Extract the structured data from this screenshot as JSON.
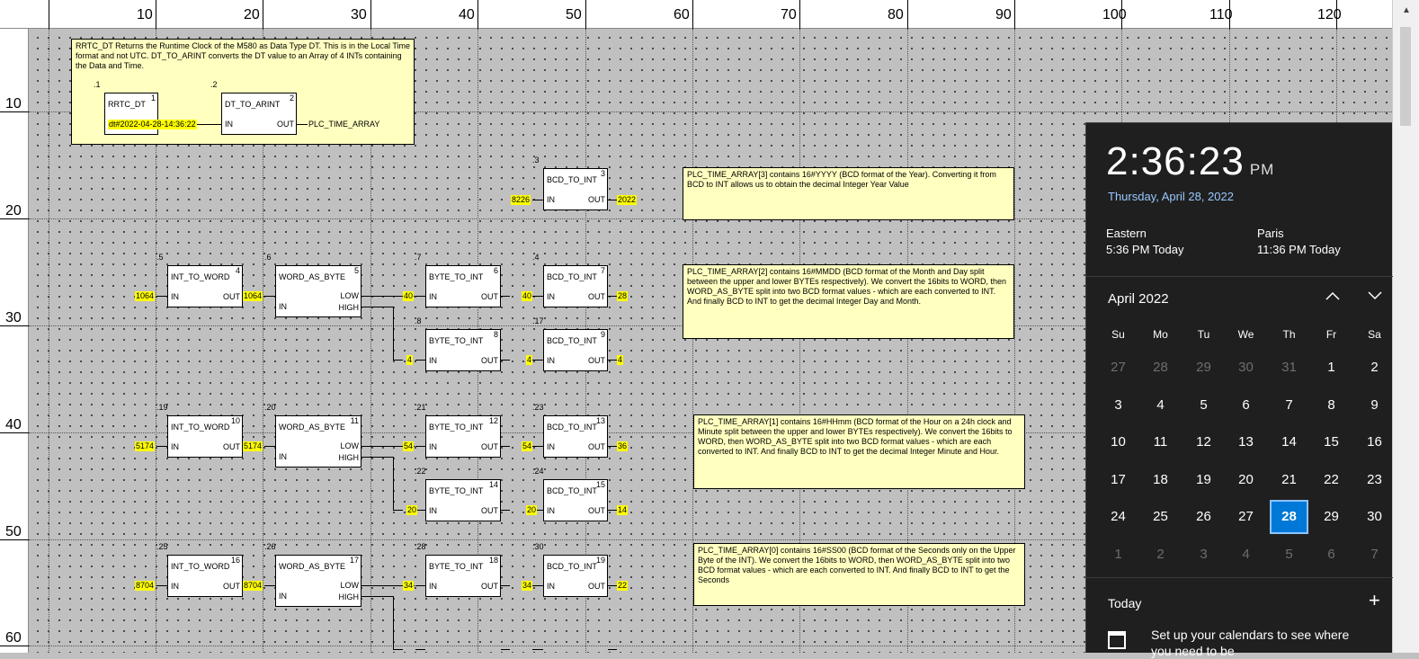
{
  "ruler": {
    "cols": [
      "10",
      "20",
      "30",
      "40",
      "50",
      "60",
      "70",
      "80",
      "90",
      "100",
      "110",
      "120"
    ],
    "rows": [
      "10",
      "20",
      "30",
      "40",
      "50",
      "60"
    ]
  },
  "comments": {
    "c1": "RRTC_DT Returns the Runtime Clock of the M580 as Data Type DT. This is in the Local Time format and not UTC. DT_TO_ARINT converts the DT value to an Array of 4 INTs containing the Data and Time.",
    "c2": "PLC_TIME_ARRAY[3] contains 16#YYYY (BCD format of the Year). Converting it from BCD to INT allows us to obtain the decimal Integer Year Value",
    "c3": "PLC_TIME_ARRAY[2] contains 16#MMDD (BCD format of the Month and Day split between the upper and lower BYTEs respectively). We convert the 16bits to WORD, then WORD_AS_BYTE split into two BCD format values - which are each converted to INT. And finally BCD to INT to get the decimal Integer Day and Month.",
    "c4": "PLC_TIME_ARRAY[1] contains 16#HHmm (BCD format of the Hour on a 24h clock and Minute split between the upper and lower BYTEs respectively). We convert the 16bits to WORD, then WORD_AS_BYTE split into two BCD format values - which are each converted to INT. And finally BCD to INT to get the decimal Integer Minute and Hour.",
    "c5": "PLC_TIME_ARRAY[0] contains 16#SS00 (BCD format of the Seconds only on the Upper Byte of the INT). We convert the 16bits to WORD, then WORD_AS_BYTE split into two BCD format values - which are each converted to INT. And finally BCD to INT to get the Seconds"
  },
  "blocks": {
    "b1": {
      "name": "RRTC_DT",
      "num": "1",
      "idx": ".1"
    },
    "b2": {
      "name": "DT_TO_ARINT",
      "num": "2",
      "idx": ".2",
      "in": "IN",
      "out": "OUT"
    },
    "b3": {
      "name": "BCD_TO_INT",
      "num": "3",
      "idx": ".3",
      "in": "IN",
      "out": "OUT"
    },
    "b4": {
      "name": "INT_TO_WORD",
      "num": "4",
      "idx": ".5",
      "in": "IN",
      "out": "OUT"
    },
    "b5": {
      "name": "WORD_AS_BYTE",
      "num": "5",
      "idx": ".6",
      "in": "IN",
      "low": "LOW",
      "high": "HIGH"
    },
    "b6": {
      "name": "BYTE_TO_INT",
      "num": "6",
      "idx": ".7",
      "in": "IN",
      "out": "OUT"
    },
    "b7": {
      "name": "BCD_TO_INT",
      "num": "7",
      "idx": ".4",
      "in": "IN",
      "out": "OUT"
    },
    "b8": {
      "name": "BYTE_TO_INT",
      "num": "8",
      "idx": ".8",
      "in": "IN",
      "out": "OUT"
    },
    "b9": {
      "name": "BCD_TO_INT",
      "num": "9",
      "idx": ".17",
      "in": "IN",
      "out": "OUT"
    },
    "b10": {
      "name": "INT_TO_WORD",
      "num": "10",
      "idx": ".19",
      "in": "IN",
      "out": "OUT"
    },
    "b11": {
      "name": "WORD_AS_BYTE",
      "num": "11",
      "idx": ".20",
      "in": "IN",
      "low": "LOW",
      "high": "HIGH"
    },
    "b12": {
      "name": "BYTE_TO_INT",
      "num": "12",
      "idx": ".21",
      "in": "IN",
      "out": "OUT"
    },
    "b13": {
      "name": "BCD_TO_INT",
      "num": "13",
      "idx": ".23",
      "in": "IN",
      "out": "OUT"
    },
    "b14": {
      "name": "BYTE_TO_INT",
      "num": "14",
      "idx": ".22",
      "in": "IN",
      "out": "OUT"
    },
    "b15": {
      "name": "BCD_TO_INT",
      "num": "15",
      "idx": ".24",
      "in": "IN",
      "out": "OUT"
    },
    "b16": {
      "name": "INT_TO_WORD",
      "num": "16",
      "idx": ".25",
      "in": "IN",
      "out": "OUT"
    },
    "b17": {
      "name": "WORD_AS_BYTE",
      "num": "17",
      "idx": ".26",
      "in": "IN",
      "low": "LOW",
      "high": "HIGH"
    },
    "b18": {
      "name": "BYTE_TO_INT",
      "num": "18",
      "idx": ".28",
      "in": "IN",
      "out": "OUT"
    },
    "b19": {
      "name": "BCD_TO_INT",
      "num": "19",
      "idx": ".30",
      "in": "IN",
      "out": "OUT"
    }
  },
  "values": {
    "dt": "dt#2022-04-28-14:36:22",
    "plc_array": "PLC_TIME_ARRAY",
    "v8226": "8226",
    "v2022": "2022",
    "v1064a": "1064",
    "v1064b": "1064",
    "v40a": "40",
    "v40b": "40",
    "v28": "28",
    "v4a": "4",
    "v4b": "4",
    "v4c": "4",
    "v5174a": "5174",
    "v5174b": "5174",
    "v54a": "54",
    "v54b": "54",
    "v36": "36",
    "v20a": "20",
    "v20b": "20",
    "v14": "14",
    "v8704a": "8704",
    "v8704b": "8704",
    "v34a": "34",
    "v34b": "34",
    "v22": "22"
  },
  "calendar": {
    "time": "2:36:23",
    "ampm": "PM",
    "date": "Thursday, April 28, 2022",
    "zones": [
      {
        "name": "Eastern",
        "time": "5:36 PM Today"
      },
      {
        "name": "Paris",
        "time": "11:36 PM Today"
      }
    ],
    "month": "April 2022",
    "up": "^",
    "down": "v",
    "weekdays": [
      "Su",
      "Mo",
      "Tu",
      "We",
      "Th",
      "Fr",
      "Sa"
    ],
    "weeks": [
      [
        "27",
        "28",
        "29",
        "30",
        "31",
        "1",
        "2"
      ],
      [
        "3",
        "4",
        "5",
        "6",
        "7",
        "8",
        "9"
      ],
      [
        "10",
        "11",
        "12",
        "13",
        "14",
        "15",
        "16"
      ],
      [
        "17",
        "18",
        "19",
        "20",
        "21",
        "22",
        "23"
      ],
      [
        "24",
        "25",
        "26",
        "27",
        "28",
        "29",
        "30"
      ],
      [
        "1",
        "2",
        "3",
        "4",
        "5",
        "6",
        "7"
      ]
    ],
    "today_label": "Today",
    "add": "+",
    "setup": "Set up your calendars to see where you need to be"
  }
}
